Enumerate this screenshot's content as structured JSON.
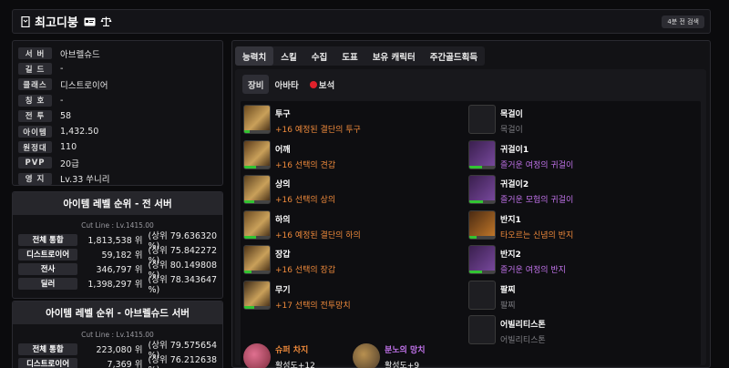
{
  "header": {
    "title": "최고디붕",
    "refresh_label": "4분 전 검색"
  },
  "profile": [
    {
      "label": "서 버",
      "value": "아브렐슈드"
    },
    {
      "label": "길 드",
      "value": "-"
    },
    {
      "label": "클래스",
      "value": "디스트로이어"
    },
    {
      "label": "칭 호",
      "value": "-"
    },
    {
      "label": "전 투",
      "value": "58"
    },
    {
      "label": "아이템",
      "value": "1,432.50"
    },
    {
      "label": "원정대",
      "value": "110"
    },
    {
      "label": "PVP",
      "value": "20급"
    },
    {
      "label": "영 지",
      "value": "Lv.33 쑤니리"
    }
  ],
  "rank_all": {
    "title": "아이템 레벨 순위 - 전 서버",
    "cutline": "Cut Line : Lv.1415.00",
    "rows": [
      {
        "label": "전체 통합",
        "rank": "1,813,538 위",
        "pct": "(상위 79.636320 %)"
      },
      {
        "label": "디스트로이어",
        "rank": "59,182 위",
        "pct": "(상위 75.842272 %)"
      },
      {
        "label": "전사",
        "rank": "346,797 위",
        "pct": "(상위 80.149808 %)"
      },
      {
        "label": "딜러",
        "rank": "1,398,297 위",
        "pct": "(상위 78.343647 %)"
      }
    ]
  },
  "rank_server": {
    "title": "아이템 레벨 순위 - 아브렐슈드 서버",
    "cutline": "Cut Line : Lv.1415.00",
    "rows": [
      {
        "label": "전체 통합",
        "rank": "223,080 위",
        "pct": "(상위 79.575654 %)"
      },
      {
        "label": "디스트로이어",
        "rank": "7,369 위",
        "pct": "(상위 76.212638 %)"
      }
    ]
  },
  "tabs": [
    "능력치",
    "스킬",
    "수집",
    "도표",
    "보유 캐릭터",
    "주간골드획득"
  ],
  "subtabs": [
    "장비",
    "아바타",
    "보석"
  ],
  "equipment": [
    {
      "name": "투구",
      "desc": "+16 예정된 결단의 투구",
      "quality": 0.2
    },
    {
      "name": "어깨",
      "desc": "+16 선택의 견갑",
      "quality": 0.45
    },
    {
      "name": "상의",
      "desc": "+16 선택의 상의",
      "quality": 0.4
    },
    {
      "name": "하의",
      "desc": "+16 예정된 결단의 하의",
      "quality": 0.45
    },
    {
      "name": "장갑",
      "desc": "+16 선택의 장갑",
      "quality": 0.3
    },
    {
      "name": "무기",
      "desc": "+17 선택의 전투망치",
      "quality": 0.4
    }
  ],
  "accessories": [
    {
      "name": "목걸이",
      "desc": "목걸이",
      "tone": "gray",
      "quality": 0
    },
    {
      "name": "귀걸이1",
      "desc": "즐거운 여정의 귀걸이",
      "tone": "purple",
      "quality": 0.5
    },
    {
      "name": "귀걸이2",
      "desc": "즐거운 모험의 귀걸이",
      "tone": "purple",
      "quality": 0.55
    },
    {
      "name": "반지1",
      "desc": "타오르는 신념의 반지",
      "tone": "orange",
      "quality": 0.3
    },
    {
      "name": "반지2",
      "desc": "즐거운 여정의 반지",
      "tone": "purple",
      "quality": 0.5
    },
    {
      "name": "팔찌",
      "desc": "팔찌",
      "tone": "gray",
      "quality": 0
    },
    {
      "name": "어빌리티스톤",
      "desc": "어빌리티스톤",
      "tone": "gray",
      "quality": 0
    }
  ],
  "engravings": [
    {
      "name": "슈퍼 차지",
      "quality": "활성도+12"
    },
    {
      "name": "분노의 망치",
      "quality": "활성도+9"
    }
  ],
  "colors": {
    "accent_red": "#e0212b",
    "orange": "#ef8a3b",
    "purple": "#c273ec",
    "green": "#32c432"
  }
}
